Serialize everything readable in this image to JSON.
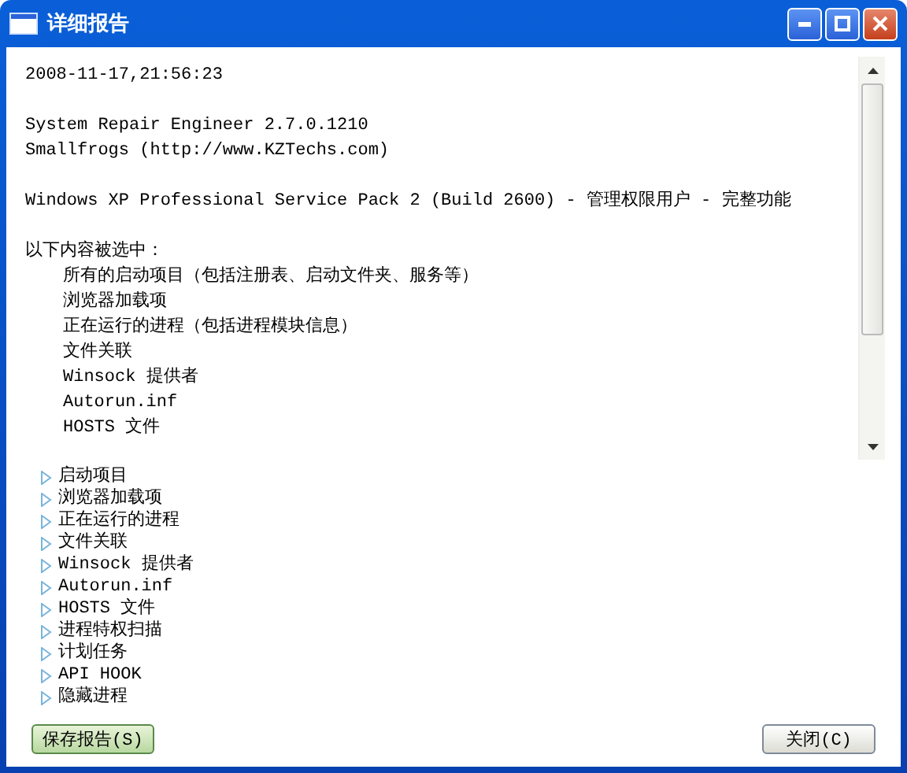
{
  "window": {
    "title": "详细报告"
  },
  "report": {
    "paragraphs": [
      {
        "lines": [
          "2008-11-17,21:56:23"
        ]
      },
      {
        "lines": [
          "System Repair Engineer 2.7.0.1210",
          "Smallfrogs (http://www.KZTechs.com)"
        ]
      },
      {
        "lines": [
          "Windows XP Professional Service Pack 2 (Build 2600) - 管理权限用户 - 完整功能"
        ]
      },
      {
        "heading": "以下内容被选中：",
        "lines": [
          "所有的启动项目（包括注册表、启动文件夹、服务等）",
          "浏览器加载项",
          "正在运行的进程（包括进程模块信息）",
          "文件关联",
          "Winsock 提供者",
          "Autorun.inf",
          "HOSTS 文件"
        ]
      }
    ]
  },
  "tree": {
    "items": [
      {
        "label": "启动项目",
        "expanded": false
      },
      {
        "label": "浏览器加载项",
        "expanded": false
      },
      {
        "label": "正在运行的进程",
        "expanded": false
      },
      {
        "label": "文件关联",
        "expanded": false
      },
      {
        "label": "Winsock 提供者",
        "expanded": false
      },
      {
        "label": "Autorun.inf",
        "expanded": false
      },
      {
        "label": "HOSTS 文件",
        "expanded": false
      },
      {
        "label": "进程特权扫描",
        "expanded": false
      },
      {
        "label": "计划任务",
        "expanded": false
      },
      {
        "label": "API HOOK",
        "expanded": false
      },
      {
        "label": "隐藏进程",
        "expanded": false
      }
    ]
  },
  "buttons": [
    {
      "label": "保存报告(S)",
      "focused": true
    },
    {
      "label": "关闭(C)",
      "focused": false
    }
  ]
}
